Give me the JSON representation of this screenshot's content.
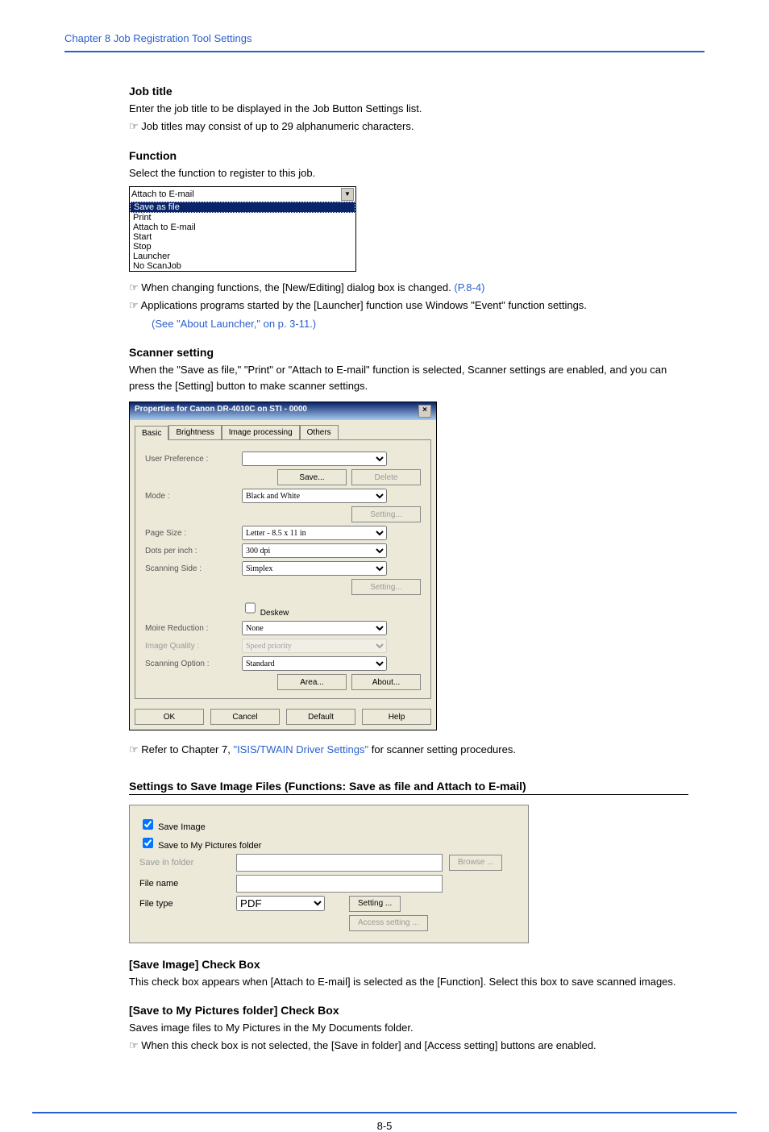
{
  "chapter": {
    "header": "Chapter 8   Job Registration Tool Settings"
  },
  "job_title": {
    "heading": "Job title",
    "line1": "Enter the job title to be displayed in the Job Button Settings list.",
    "note": "Job titles may consist of up to 29 alphanumeric characters."
  },
  "function_sec": {
    "heading": "Function",
    "line1": "Select the function to register to this job.",
    "dropdown_top": "Attach to E-mail",
    "options": [
      "Save as file",
      "Print",
      "Attach to E-mail",
      "Start",
      "Stop",
      "Launcher",
      "No ScanJob"
    ],
    "note1_pre": "When changing functions, the [New/Editing] dialog box is changed. ",
    "note1_link": "(P.8-4)",
    "note2_pre": "Applications programs started by the [Launcher] function use Windows \"Event\" function settings. ",
    "note2_link": "(See \"About Launcher,\" on p. 3-11.)"
  },
  "scanner": {
    "heading": "Scanner setting",
    "para": "When the \"Save as file,\" \"Print\" or \"Attach to E-mail\" function is selected, Scanner settings are enabled, and you can press the [Setting] button to make scanner settings.",
    "dialog_title": "Properties for Canon DR-4010C on STI - 0000",
    "tabs": [
      "Basic",
      "Brightness",
      "Image processing",
      "Others"
    ],
    "labels": {
      "user_pref": "User Preference :",
      "mode": "Mode :",
      "page_size": "Page Size :",
      "dpi": "Dots per inch :",
      "side": "Scanning Side :",
      "deskew": "Deskew",
      "moire": "Moire Reduction :",
      "quality": "Image Quality :",
      "option": "Scanning Option :"
    },
    "values": {
      "mode": "Black and White",
      "page_size": "Letter - 8.5 x 11 in",
      "dpi": "300 dpi",
      "side": "Simplex",
      "moire": "None",
      "quality": "Speed priority",
      "option": "Standard"
    },
    "buttons": {
      "save": "Save...",
      "delete": "Delete",
      "setting": "Setting...",
      "area": "Area...",
      "about": "About...",
      "ok": "OK",
      "cancel": "Cancel",
      "default": "Default",
      "help": "Help"
    },
    "after_note_pre": "Refer to Chapter 7, ",
    "after_note_link": "\"ISIS/TWAIN Driver Settings\"",
    "after_note_post": " for scanner setting procedures."
  },
  "save_sec": {
    "heading": "Settings to Save Image Files (Functions: Save as file and Attach to E-mail)",
    "panel": {
      "cb1": "Save Image",
      "cb2": "Save to My Pictures folder",
      "save_in": "Save in folder",
      "file_name": "File name",
      "file_type": "File type",
      "file_type_val": "PDF",
      "browse": "Browse ...",
      "setting": "Setting ...",
      "access": "Access setting ..."
    },
    "sub1_heading": "[Save Image] Check Box",
    "sub1_text": "This check box appears when [Attach to E-mail] is selected as the [Function]. Select this box to save scanned images.",
    "sub2_heading": "[Save to My Pictures folder] Check Box",
    "sub2_text": "Saves image files to My Pictures in the My Documents folder.",
    "sub2_note": "When this check box is not selected, the [Save in folder] and [Access setting] buttons are enabled."
  },
  "page_number": "8-5",
  "pointer_glyph": "☞"
}
